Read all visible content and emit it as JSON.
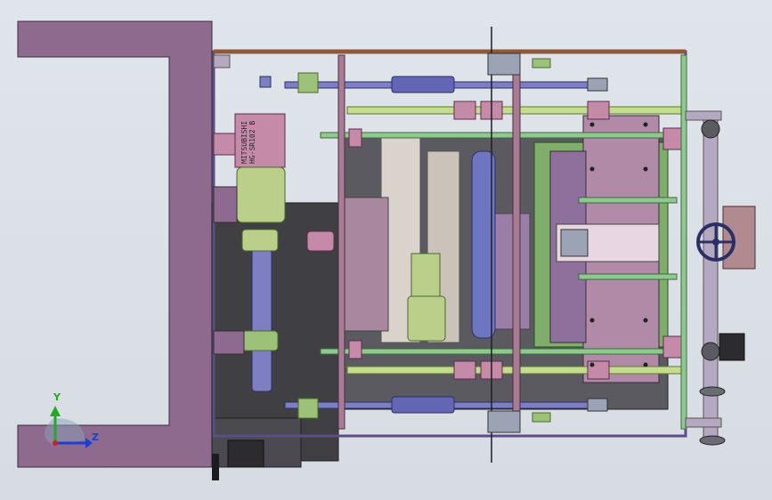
{
  "motor": {
    "label_line1": "MITSUBISHI",
    "label_line2": "HG-SR102 B"
  },
  "triad": {
    "x_label": "",
    "y_label": "Y",
    "z_label": "Z",
    "y_color": "#22aa22",
    "z_color": "#1f3fcf",
    "x_color": "#cc2222"
  },
  "colors": {
    "background": "#d6dce2",
    "frame": "#8e6a8f",
    "plate": "#9c8aa2",
    "shaft": "#7d7fc2",
    "green": "#9cc27a",
    "pink": "#c48aa8",
    "dark": "#3f3f44",
    "bronze": "#8a5a3a"
  },
  "icons": {
    "handwheel": "handwheel-icon",
    "servo_motor": "servo-motor-icon",
    "coordinate_triad": "coordinate-triad-icon"
  }
}
